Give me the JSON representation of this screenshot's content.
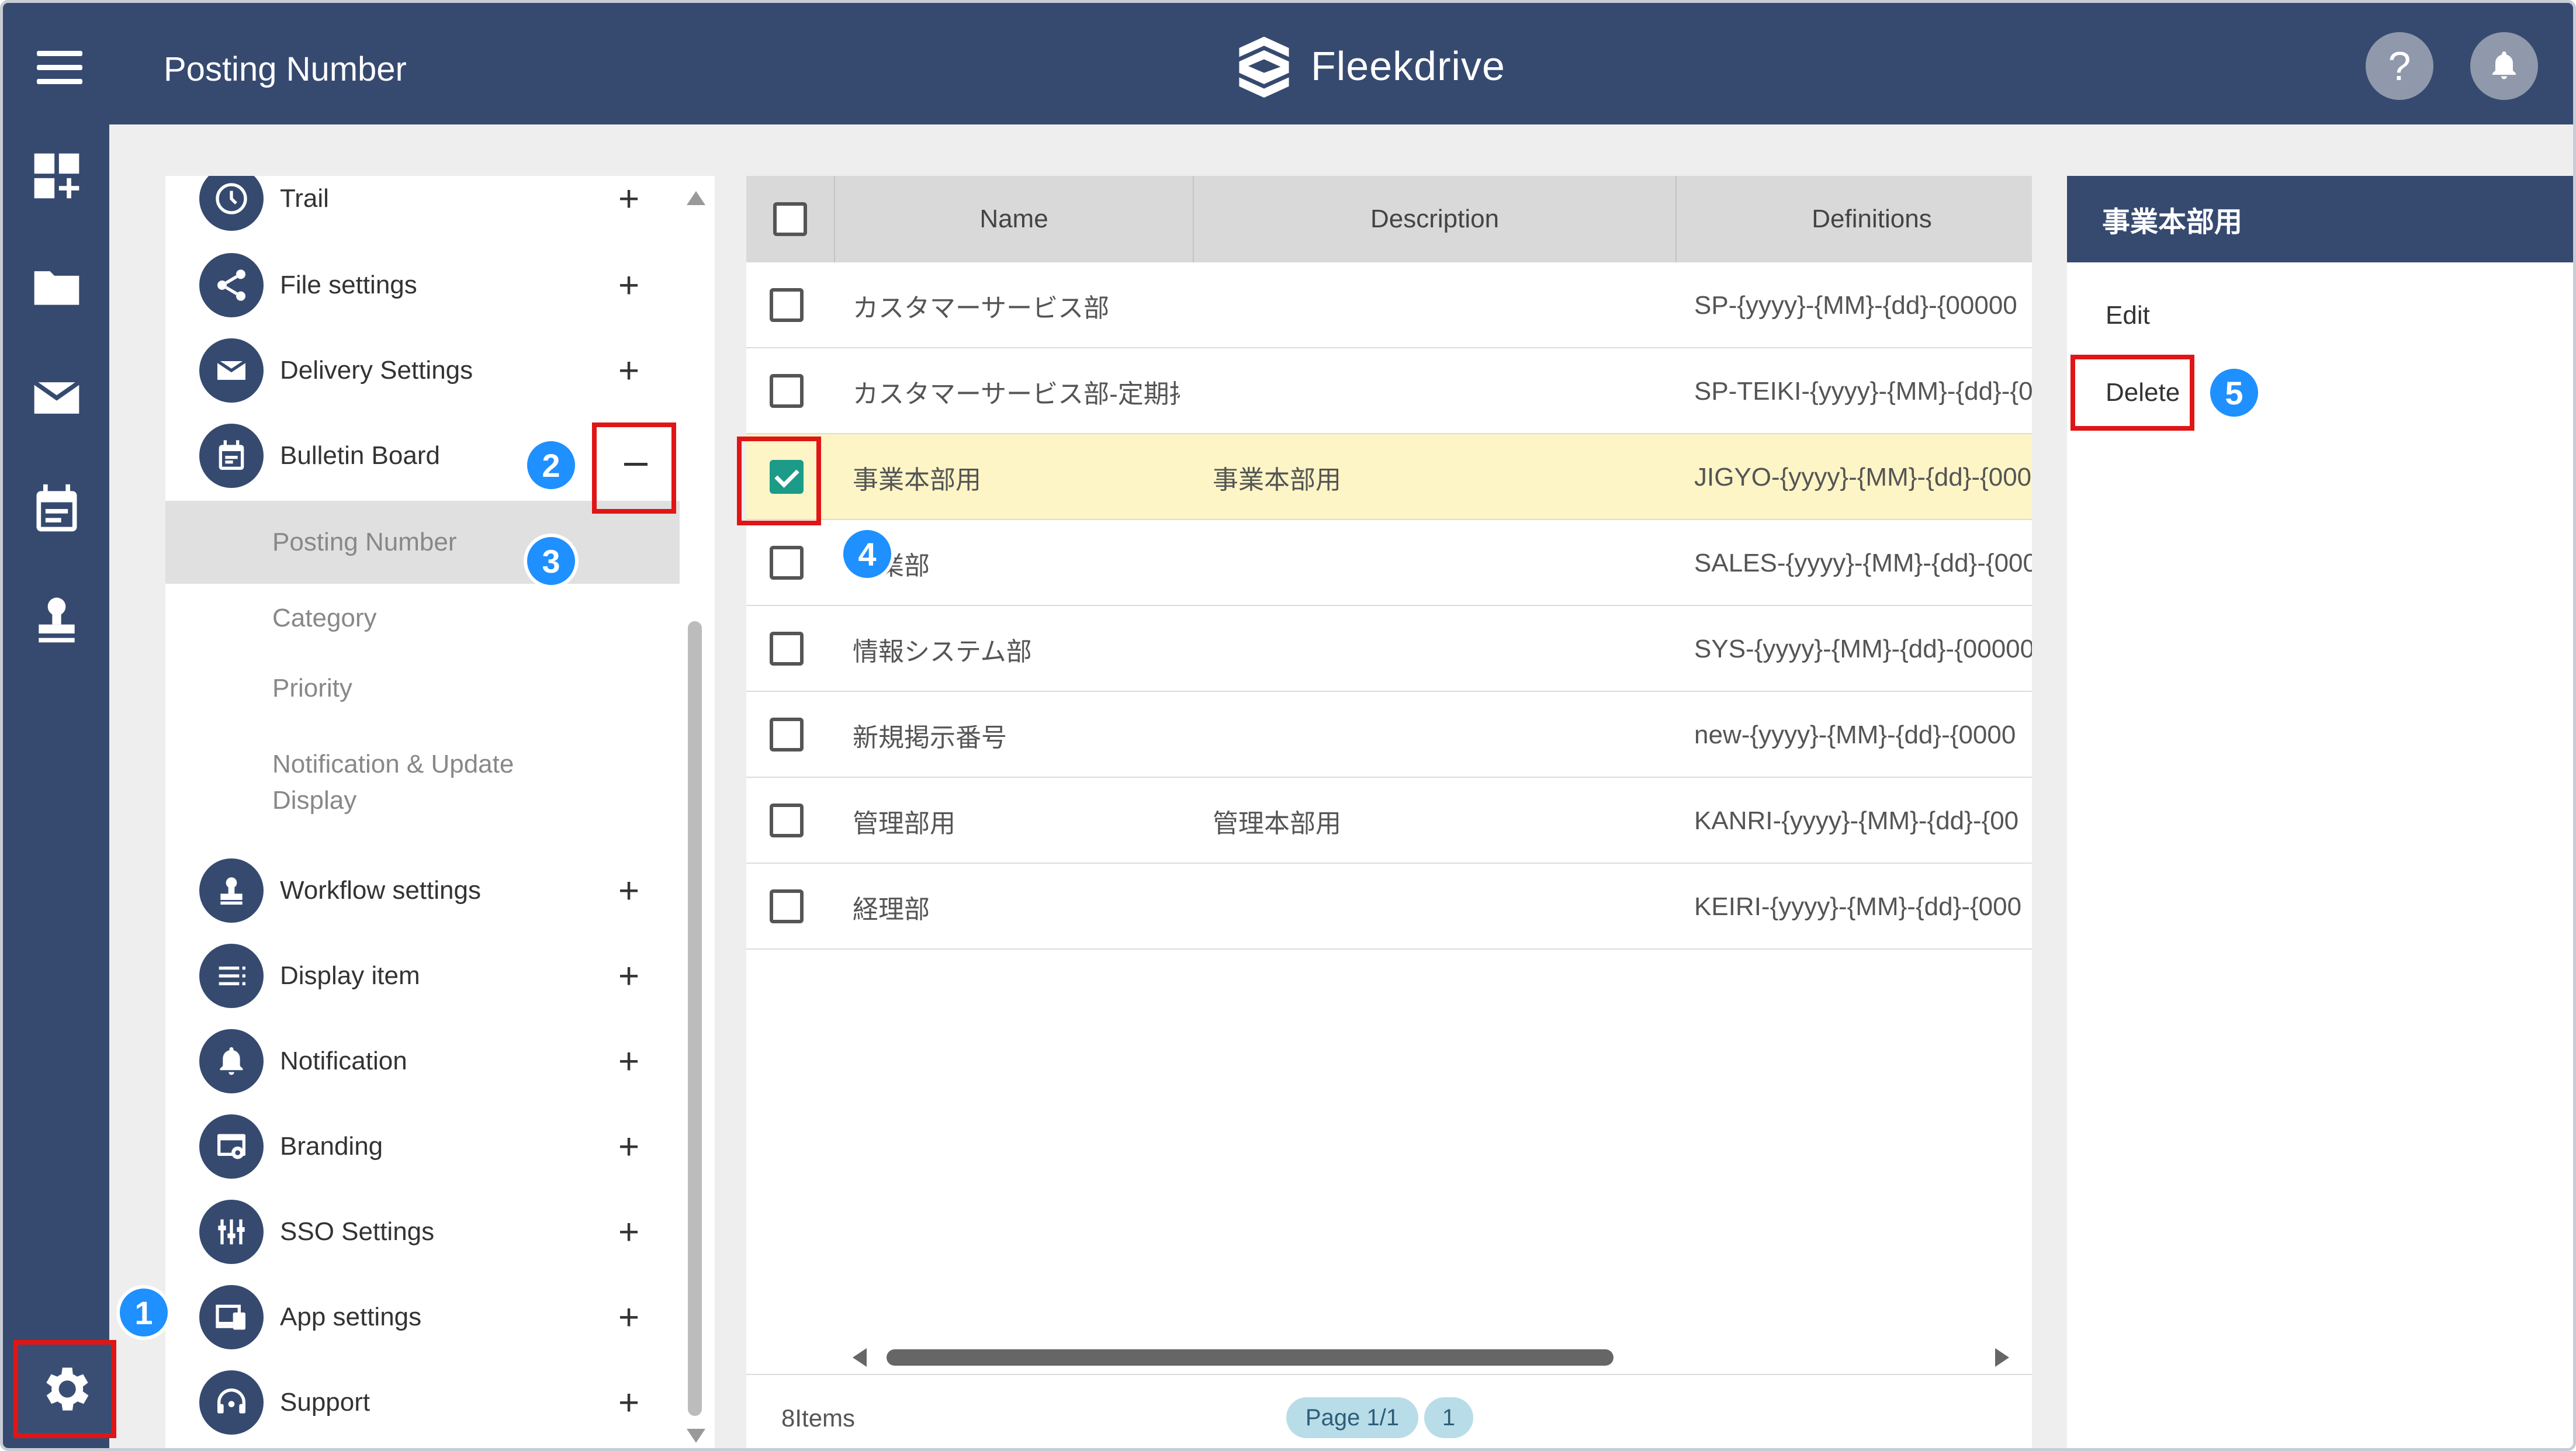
{
  "header": {
    "title": "Posting Number",
    "logo_text": "Fleekdrive",
    "help_label": "?"
  },
  "rail": {
    "items": [
      "dashboard-icon",
      "folder-icon",
      "mail-icon",
      "calendar-icon",
      "stamp-icon",
      "gear-icon"
    ]
  },
  "menu": {
    "items": [
      {
        "label": "Trail",
        "icon": "clock-icon"
      },
      {
        "label": "File settings",
        "icon": "share-icon"
      },
      {
        "label": "Delivery Settings",
        "icon": "mail-icon"
      },
      {
        "label": "Bulletin Board",
        "icon": "calendar-icon",
        "expanded": true
      },
      {
        "label": "Workflow settings",
        "icon": "stamp-icon"
      },
      {
        "label": "Display item",
        "icon": "list-icon"
      },
      {
        "label": "Notification",
        "icon": "bell-icon"
      },
      {
        "label": "Branding",
        "icon": "branding-icon"
      },
      {
        "label": "SSO Settings",
        "icon": "sso-icon"
      },
      {
        "label": "App settings",
        "icon": "devices-icon"
      },
      {
        "label": "Support",
        "icon": "headset-icon"
      }
    ],
    "sub_items": [
      "Posting Number",
      "Category",
      "Priority",
      "Notification & Update",
      "Display"
    ],
    "plus": "+",
    "minus": "−"
  },
  "table": {
    "columns": [
      "Name",
      "Description",
      "Definitions"
    ],
    "rows": [
      {
        "name": "カスタマーサービス部",
        "description": "",
        "definition": "SP-{yyyy}-{MM}-{dd}-{00000"
      },
      {
        "name": "カスタマーサービス部-定期掲",
        "description": "",
        "definition": "SP-TEIKI-{yyyy}-{MM}-{dd}-{0"
      },
      {
        "name": "事業本部用",
        "description": "事業本部用",
        "definition": "JIGYO-{yyyy}-{MM}-{dd}-{000",
        "checked": true
      },
      {
        "name": "営業部",
        "description": "",
        "definition": "SALES-{yyyy}-{MM}-{dd}-{000"
      },
      {
        "name": "情報システム部",
        "description": "",
        "definition": "SYS-{yyyy}-{MM}-{dd}-{00000"
      },
      {
        "name": "新規掲示番号",
        "description": "",
        "definition": "new-{yyyy}-{MM}-{dd}-{0000"
      },
      {
        "name": "管理部用",
        "description": "管理本部用",
        "definition": "KANRI-{yyyy}-{MM}-{dd}-{00"
      },
      {
        "name": "経理部",
        "description": "",
        "definition": "KEIRI-{yyyy}-{MM}-{dd}-{000"
      }
    ],
    "items_count": "8Items",
    "page_label": "Page 1/1",
    "page_number": "1"
  },
  "detail": {
    "title": "事業本部用",
    "edit_label": "Edit",
    "delete_label": "Delete"
  },
  "badges": [
    "1",
    "2",
    "3",
    "4",
    "5"
  ],
  "colors": {
    "navy": "#364a70",
    "highlight": "#e01515",
    "badge": "#1e90ff",
    "check": "#1b9b88",
    "selected_row": "#fdf5c6"
  }
}
